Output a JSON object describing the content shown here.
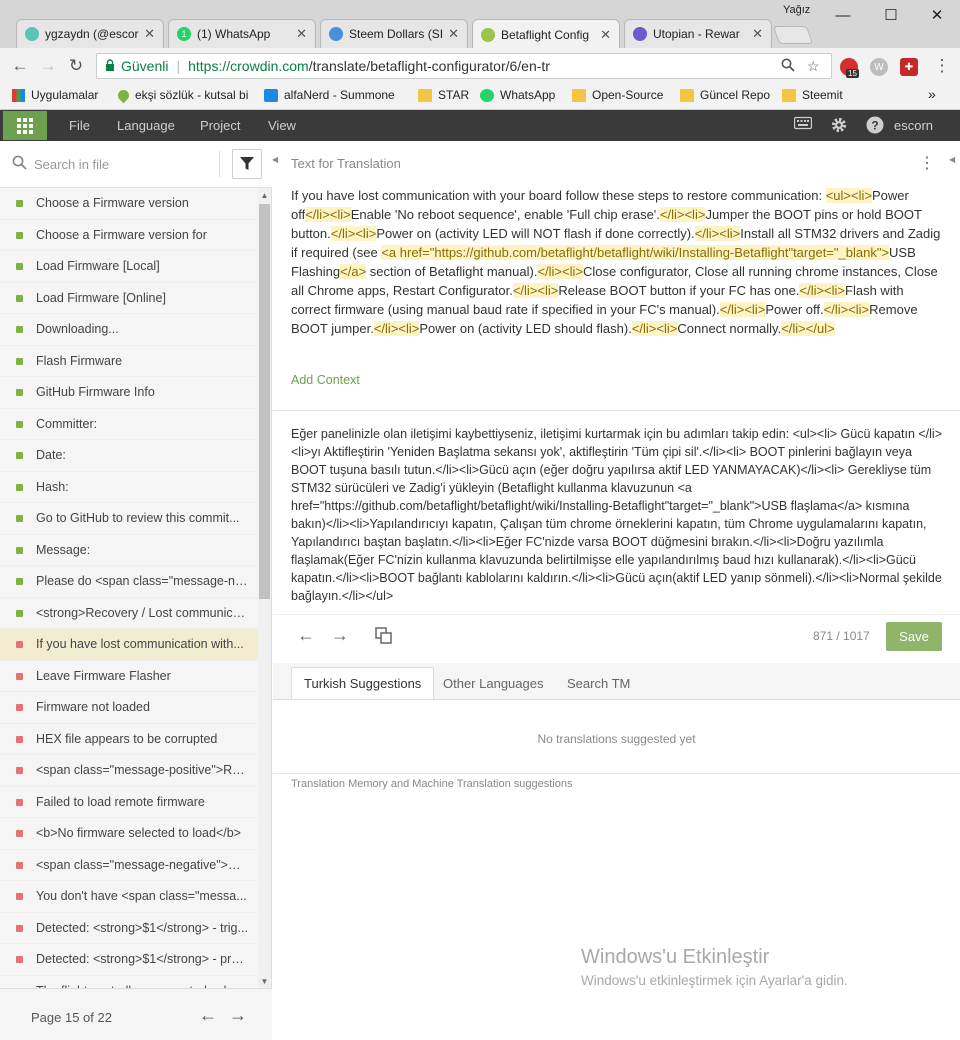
{
  "window": {
    "user": "Yağız",
    "controls": {
      "minimize": "—",
      "maximize": "☐",
      "close": "✕"
    }
  },
  "tabs": [
    {
      "label": "ygzaydn (@escor",
      "color": "#5bc4b4",
      "glyph": ""
    },
    {
      "label": "(1) WhatsApp",
      "color": "#25d366",
      "glyph": "1"
    },
    {
      "label": "Steem Dollars (SI",
      "color": "#4a90d9",
      "glyph": ""
    },
    {
      "label": "Betaflight Config",
      "color": "#9ac447",
      "glyph": ""
    },
    {
      "label": "Utopian - Rewar",
      "color": "#6a5acd",
      "glyph": ""
    }
  ],
  "tab_close": "✕",
  "address": {
    "secure_label": "Güvenli",
    "url_scheme_host": "https://crowdin.com",
    "url_path": "/translate/betaflight-configurator/6/en-tr",
    "back": "←",
    "forward": "→",
    "reload": "↻",
    "badge": "15",
    "more": "⋮"
  },
  "bookmarks": [
    {
      "label": "Uygulamalar",
      "type": "apps"
    },
    {
      "label": "ekşi sözlük - kutsal bi",
      "type": "drop"
    },
    {
      "label": "alfaNerd - Summone",
      "type": "blue"
    },
    {
      "label": "STAR",
      "type": "folder"
    },
    {
      "label": "WhatsApp",
      "type": "wa"
    },
    {
      "label": "Open-Source",
      "type": "folder"
    },
    {
      "label": "Güncel Repo",
      "type": "folder"
    },
    {
      "label": "Steemit",
      "type": "folder"
    }
  ],
  "bookmarks_more": "»",
  "crowdin": {
    "menu": [
      "File",
      "Language",
      "Project",
      "View"
    ],
    "user": "escorn"
  },
  "sidebar": {
    "search_placeholder": "Search in file",
    "strings": [
      {
        "label": "Choose a Firmware version",
        "status": "translated"
      },
      {
        "label": "Choose a Firmware version for",
        "status": "translated"
      },
      {
        "label": "Load Firmware [Local]",
        "status": "translated"
      },
      {
        "label": "Load Firmware [Online]",
        "status": "translated"
      },
      {
        "label": "Downloading...",
        "status": "translated"
      },
      {
        "label": "Flash Firmware",
        "status": "translated"
      },
      {
        "label": "GitHub Firmware Info",
        "status": "translated"
      },
      {
        "label": "Committer:",
        "status": "translated"
      },
      {
        "label": "Date:",
        "status": "translated"
      },
      {
        "label": "Hash:",
        "status": "translated"
      },
      {
        "label": "Go to GitHub to review this commit...",
        "status": "translated"
      },
      {
        "label": "Message:",
        "status": "translated"
      },
      {
        "label": "Please do <span class=\"message-ne...",
        "status": "translated"
      },
      {
        "label": "<strong>Recovery / Lost communica...",
        "status": "translated"
      },
      {
        "label": "If you have lost communication with...",
        "status": "active"
      },
      {
        "label": "Leave Firmware Flasher",
        "status": "untranslated"
      },
      {
        "label": "Firmware not loaded",
        "status": "untranslated"
      },
      {
        "label": "HEX file appears to be corrupted",
        "status": "untranslated"
      },
      {
        "label": "<span class=\"message-positive\">Re...",
        "status": "untranslated"
      },
      {
        "label": "Failed to load remote firmware",
        "status": "untranslated"
      },
      {
        "label": "<b>No firmware selected to load</b>",
        "status": "untranslated"
      },
      {
        "label": "<span class=\"message-negative\">Pl...",
        "status": "untranslated"
      },
      {
        "label": "You don't have <span class=\"messa...",
        "status": "untranslated"
      },
      {
        "label": "Detected: <strong>$1</strong> - trig...",
        "status": "untranslated"
      },
      {
        "label": "Detected: <strong>$1</strong> - pre...",
        "status": "untranslated"
      },
      {
        "label": "The flight controller can control colo...",
        "status": "untranslated"
      }
    ],
    "page_label": "Page 15 of 22"
  },
  "main": {
    "source_header": "Text for Translation",
    "source_segments": [
      {
        "t": "If you have lost communication with your board follow these steps to restore communication: ",
        "tag": false
      },
      {
        "t": "<ul><li>",
        "tag": true
      },
      {
        "t": "Power off",
        "tag": false
      },
      {
        "t": "</li><li>",
        "tag": true
      },
      {
        "t": "Enable 'No reboot sequence', enable 'Full chip erase'.",
        "tag": false
      },
      {
        "t": "</li><li>",
        "tag": true
      },
      {
        "t": "Jumper the BOOT pins or hold BOOT button.",
        "tag": false
      },
      {
        "t": "</li><li>",
        "tag": true
      },
      {
        "t": "Power on (activity LED will NOT flash if done correctly).",
        "tag": false
      },
      {
        "t": "</li><li>",
        "tag": true
      },
      {
        "t": "Install all STM32 drivers and Zadig if required (see ",
        "tag": false
      },
      {
        "t": "<a href=\"https://github.com/betaflight/betaflight/wiki/Installing-Betaflight\"target=\"_blank\">",
        "tag": true
      },
      {
        "t": "USB Flashing",
        "tag": false
      },
      {
        "t": "</a>",
        "tag": true
      },
      {
        "t": " section of Betaflight manual).",
        "tag": false
      },
      {
        "t": "</li><li>",
        "tag": true
      },
      {
        "t": "Close configurator, Close all running chrome instances, Close all Chrome apps, Restart Configurator.",
        "tag": false
      },
      {
        "t": "</li><li>",
        "tag": true
      },
      {
        "t": "Release BOOT button if your FC has one.",
        "tag": false
      },
      {
        "t": "</li><li>",
        "tag": true
      },
      {
        "t": "Flash with correct firmware (using manual baud rate if specified in your FC's manual).",
        "tag": false
      },
      {
        "t": "</li><li>",
        "tag": true
      },
      {
        "t": "Power off.",
        "tag": false
      },
      {
        "t": "</li><li>",
        "tag": true
      },
      {
        "t": "Remove BOOT jumper.",
        "tag": false
      },
      {
        "t": "</li><li>",
        "tag": true
      },
      {
        "t": "Power on (activity LED should flash).",
        "tag": false
      },
      {
        "t": "</li><li>",
        "tag": true
      },
      {
        "t": "Connect normally.",
        "tag": false
      },
      {
        "t": "</li></ul>",
        "tag": true
      }
    ],
    "add_context": "Add Context",
    "translation": "Eğer panelinizle olan iletişimi kaybettiyseniz, iletişimi kurtarmak için bu adımları takip edin: <ul><li> Gücü kapatın </li><li>yı Aktifleştirin 'Yeniden Başlatma sekansı yok', aktifleştirin 'Tüm çipi sil'.</li><li> BOOT pinlerini bağlayın  veya BOOT tuşuna basılı tutun.</li><li>Gücü açın (eğer doğru yapılırsa aktif LED YANMAYACAK)</li><li> Gerekliyse tüm STM32 sürücüleri ve Zadig'i yükleyin (Betaflight kullanma klavuzunun <a href=\"https://github.com/betaflight/betaflight/wiki/Installing-Betaflight\"target=\"_blank\">USB flaşlama</a> kısmına bakın)</li><li>Yapılandırıcıyı kapatın, Çalışan tüm chrome örneklerini kapatın, tüm Chrome uygulamalarını kapatın, Yapılandırıcı baştan başlatın.</li><li>Eğer FC'nizde varsa BOOT düğmesini bırakın.</li><li>Doğru yazılımla flaşlamak(Eğer FC'nizin kullanma klavuzunda belirtilmişse elle yapılandırılmış baud hızı kullanarak).</li><li>Gücü kapatın.</li><li>BOOT bağlantı kablolarını kaldırın.</li><li>Gücü açın(aktif LED yanıp sönmeli).</li><li>Normal şekilde bağlayın.</li></ul>",
    "counter": "871 / 1017",
    "save_label": "Save",
    "suggestion_tabs": [
      "Turkish Suggestions",
      "Other Languages",
      "Search TM"
    ],
    "no_suggestions": "No translations suggested yet",
    "tm_label": "Translation Memory and Machine Translation suggestions"
  },
  "watermark": {
    "title": "Windows'u Etkinleştir",
    "subtitle": "Windows'u etkinleştirmek için Ayarlar'a gidin."
  },
  "colors": {
    "accent_green": "#6ea14f",
    "translated": "#7cb342",
    "untranslated": "#e57373",
    "header_dark": "#3a3a3a"
  }
}
